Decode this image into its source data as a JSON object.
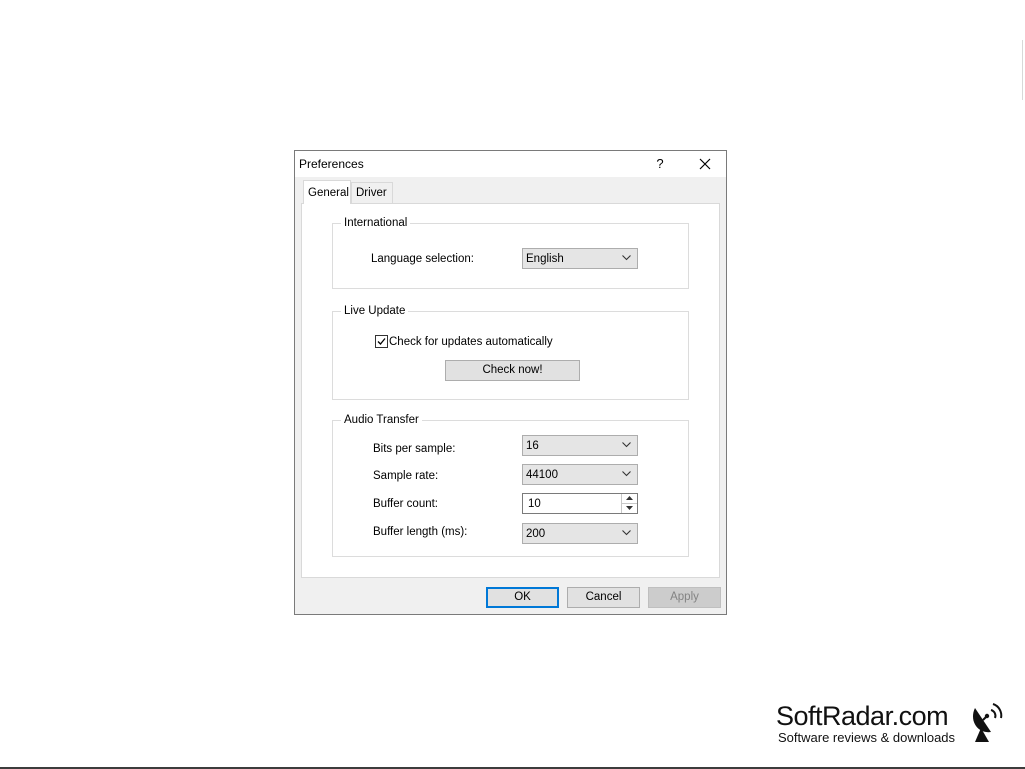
{
  "dialog": {
    "title": "Preferences",
    "help_label": "?",
    "tabs": [
      {
        "label": "General",
        "active": true
      },
      {
        "label": "Driver",
        "active": false
      }
    ],
    "international": {
      "legend": "International",
      "language_label": "Language selection:",
      "language_value": "English"
    },
    "live_update": {
      "legend": "Live Update",
      "auto_check_label": "Check for updates automatically",
      "auto_check_checked": true,
      "check_now_label": "Check now!"
    },
    "audio_transfer": {
      "legend": "Audio Transfer",
      "bits_label": "Bits per sample:",
      "bits_value": "16",
      "rate_label": "Sample rate:",
      "rate_value": "44100",
      "buffer_count_label": "Buffer count:",
      "buffer_count_value": "10",
      "buffer_length_label": "Buffer length (ms):",
      "buffer_length_value": "200"
    },
    "buttons": {
      "ok": "OK",
      "cancel": "Cancel",
      "apply": "Apply"
    }
  },
  "watermark": {
    "name": "SoftRadar.com",
    "tagline": "Software reviews & downloads"
  },
  "colors": {
    "accent": "#0078d7",
    "dialog_bg": "#f0f0f0",
    "panel_bg": "#ffffff"
  }
}
